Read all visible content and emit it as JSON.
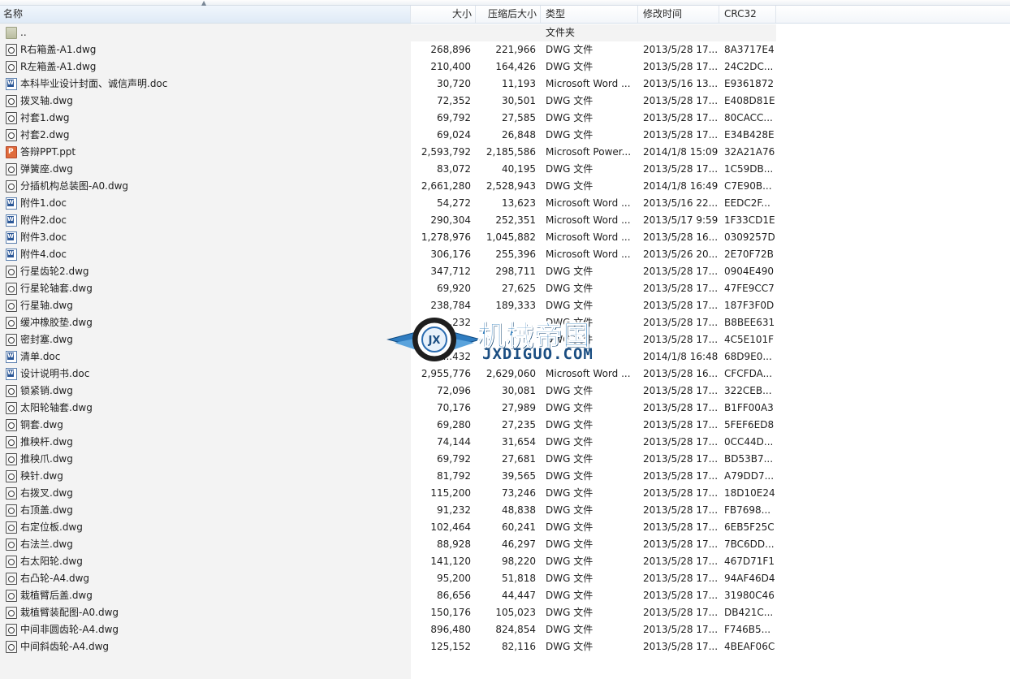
{
  "columns": {
    "name": "名称",
    "size": "大小",
    "packed": "压缩后大小",
    "type": "类型",
    "modified": "修改时间",
    "crc": "CRC32"
  },
  "parent_row": {
    "name": "..",
    "type": "文件夹"
  },
  "files": [
    {
      "name": "R右箱盖-A1.dwg",
      "size": "268,896",
      "packed": "221,966",
      "type": "DWG 文件",
      "modified": "2013/5/28 17...",
      "crc": "8A3717E4",
      "icon": "dwg-file-icon"
    },
    {
      "name": "R左箱盖-A1.dwg",
      "size": "210,400",
      "packed": "164,426",
      "type": "DWG 文件",
      "modified": "2013/5/28 17...",
      "crc": "24C2DC...",
      "icon": "dwg-file-icon"
    },
    {
      "name": "本科毕业设计封面、诚信声明.doc",
      "size": "30,720",
      "packed": "11,193",
      "type": "Microsoft Word ...",
      "modified": "2013/5/16 13...",
      "crc": "E9361872",
      "icon": "word-doc-icon"
    },
    {
      "name": "拨叉轴.dwg",
      "size": "72,352",
      "packed": "30,501",
      "type": "DWG 文件",
      "modified": "2013/5/28 17...",
      "crc": "E408D81E",
      "icon": "dwg-file-icon"
    },
    {
      "name": "衬套1.dwg",
      "size": "69,792",
      "packed": "27,585",
      "type": "DWG 文件",
      "modified": "2013/5/28 17...",
      "crc": "80CACC...",
      "icon": "dwg-file-icon"
    },
    {
      "name": "衬套2.dwg",
      "size": "69,024",
      "packed": "26,848",
      "type": "DWG 文件",
      "modified": "2013/5/28 17...",
      "crc": "E34B428E",
      "icon": "dwg-file-icon"
    },
    {
      "name": "答辩PPT.ppt",
      "size": "2,593,792",
      "packed": "2,185,586",
      "type": "Microsoft Power...",
      "modified": "2014/1/8 15:09",
      "crc": "32A21A76",
      "icon": "powerpoint-icon"
    },
    {
      "name": "弹簧座.dwg",
      "size": "83,072",
      "packed": "40,195",
      "type": "DWG 文件",
      "modified": "2013/5/28 17...",
      "crc": "1C59DB...",
      "icon": "dwg-file-icon"
    },
    {
      "name": "分插机构总装图-A0.dwg",
      "size": "2,661,280",
      "packed": "2,528,943",
      "type": "DWG 文件",
      "modified": "2014/1/8 16:49",
      "crc": "C7E90B...",
      "icon": "dwg-file-icon"
    },
    {
      "name": "附件1.doc",
      "size": "54,272",
      "packed": "13,623",
      "type": "Microsoft Word ...",
      "modified": "2013/5/16 22...",
      "crc": "EEDC2F...",
      "icon": "word-doc-icon"
    },
    {
      "name": "附件2.doc",
      "size": "290,304",
      "packed": "252,351",
      "type": "Microsoft Word ...",
      "modified": "2013/5/17 9:59",
      "crc": "1F33CD1E",
      "icon": "word-doc-icon"
    },
    {
      "name": "附件3.doc",
      "size": "1,278,976",
      "packed": "1,045,882",
      "type": "Microsoft Word ...",
      "modified": "2013/5/28 16...",
      "crc": "0309257D",
      "icon": "word-doc-icon"
    },
    {
      "name": "附件4.doc",
      "size": "306,176",
      "packed": "255,396",
      "type": "Microsoft Word ...",
      "modified": "2013/5/26 20...",
      "crc": "2E70F72B",
      "icon": "word-doc-icon"
    },
    {
      "name": "行星齿轮2.dwg",
      "size": "347,712",
      "packed": "298,711",
      "type": "DWG 文件",
      "modified": "2013/5/28 17...",
      "crc": "0904E490",
      "icon": "dwg-file-icon"
    },
    {
      "name": "行星轮轴套.dwg",
      "size": "69,920",
      "packed": "27,625",
      "type": "DWG 文件",
      "modified": "2013/5/28 17...",
      "crc": "47FE9CC7",
      "icon": "dwg-file-icon"
    },
    {
      "name": "行星轴.dwg",
      "size": "238,784",
      "packed": "189,333",
      "type": "DWG 文件",
      "modified": "2013/5/28 17...",
      "crc": "187F3F0D",
      "icon": "dwg-file-icon"
    },
    {
      "name": "缓冲橡胶垫.dwg",
      "size": "...232",
      "packed": "",
      "type": "DWG 文件",
      "modified": "2013/5/28 17...",
      "crc": "B8BEE631",
      "icon": "dwg-file-icon"
    },
    {
      "name": "密封塞.dwg",
      "size": "",
      "packed": "",
      "type": "DWG 文件",
      "modified": "2013/5/28 17...",
      "crc": "4C5E101F",
      "icon": "dwg-file-icon"
    },
    {
      "name": "清单.doc",
      "size": "...432",
      "packed": "",
      "type": "",
      "modified": "2014/1/8 16:48",
      "crc": "68D9E0...",
      "icon": "word-doc-icon"
    },
    {
      "name": "设计说明书.doc",
      "size": "2,955,776",
      "packed": "2,629,060",
      "type": "Microsoft Word ...",
      "modified": "2013/5/28 16...",
      "crc": "CFCFDA...",
      "icon": "word-doc-icon"
    },
    {
      "name": "锁紧销.dwg",
      "size": "72,096",
      "packed": "30,081",
      "type": "DWG 文件",
      "modified": "2013/5/28 17...",
      "crc": "322CEB...",
      "icon": "dwg-file-icon"
    },
    {
      "name": "太阳轮轴套.dwg",
      "size": "70,176",
      "packed": "27,989",
      "type": "DWG 文件",
      "modified": "2013/5/28 17...",
      "crc": "B1FF00A3",
      "icon": "dwg-file-icon"
    },
    {
      "name": "铜套.dwg",
      "size": "69,280",
      "packed": "27,235",
      "type": "DWG 文件",
      "modified": "2013/5/28 17...",
      "crc": "5FEF6ED8",
      "icon": "dwg-file-icon"
    },
    {
      "name": "推秧杆.dwg",
      "size": "74,144",
      "packed": "31,654",
      "type": "DWG 文件",
      "modified": "2013/5/28 17...",
      "crc": "0CC44D...",
      "icon": "dwg-file-icon"
    },
    {
      "name": "推秧爪.dwg",
      "size": "69,792",
      "packed": "27,681",
      "type": "DWG 文件",
      "modified": "2013/5/28 17...",
      "crc": "BD53B7...",
      "icon": "dwg-file-icon"
    },
    {
      "name": "秧针.dwg",
      "size": "81,792",
      "packed": "39,565",
      "type": "DWG 文件",
      "modified": "2013/5/28 17...",
      "crc": "A79DD7...",
      "icon": "dwg-file-icon"
    },
    {
      "name": "右拨叉.dwg",
      "size": "115,200",
      "packed": "73,246",
      "type": "DWG 文件",
      "modified": "2013/5/28 17...",
      "crc": "18D10E24",
      "icon": "dwg-file-icon"
    },
    {
      "name": "右顶盖.dwg",
      "size": "91,232",
      "packed": "48,838",
      "type": "DWG 文件",
      "modified": "2013/5/28 17...",
      "crc": "FB7698...",
      "icon": "dwg-file-icon"
    },
    {
      "name": "右定位板.dwg",
      "size": "102,464",
      "packed": "60,241",
      "type": "DWG 文件",
      "modified": "2013/5/28 17...",
      "crc": "6EB5F25C",
      "icon": "dwg-file-icon"
    },
    {
      "name": "右法兰.dwg",
      "size": "88,928",
      "packed": "46,297",
      "type": "DWG 文件",
      "modified": "2013/5/28 17...",
      "crc": "7BC6DD...",
      "icon": "dwg-file-icon"
    },
    {
      "name": "右太阳轮.dwg",
      "size": "141,120",
      "packed": "98,220",
      "type": "DWG 文件",
      "modified": "2013/5/28 17...",
      "crc": "467D71F1",
      "icon": "dwg-file-icon"
    },
    {
      "name": "右凸轮-A4.dwg",
      "size": "95,200",
      "packed": "51,818",
      "type": "DWG 文件",
      "modified": "2013/5/28 17...",
      "crc": "94AF46D4",
      "icon": "dwg-file-icon"
    },
    {
      "name": "栽植臂后盖.dwg",
      "size": "86,656",
      "packed": "44,447",
      "type": "DWG 文件",
      "modified": "2013/5/28 17...",
      "crc": "31980C46",
      "icon": "dwg-file-icon"
    },
    {
      "name": "栽植臂装配图-A0.dwg",
      "size": "150,176",
      "packed": "105,023",
      "type": "DWG 文件",
      "modified": "2013/5/28 17...",
      "crc": "DB421C...",
      "icon": "dwg-file-icon"
    },
    {
      "name": "中间非圆齿轮-A4.dwg",
      "size": "896,480",
      "packed": "824,854",
      "type": "DWG 文件",
      "modified": "2013/5/28 17...",
      "crc": "F746B5...",
      "icon": "dwg-file-icon"
    },
    {
      "name": "中间斜齿轮-A4.dwg",
      "size": "125,152",
      "packed": "82,116",
      "type": "DWG 文件",
      "modified": "2013/5/28 17...",
      "crc": "4BEAF06C",
      "icon": "dwg-file-icon"
    }
  ],
  "watermark": {
    "title": "机械帝国",
    "url": "JXDIGUO.COM",
    "emblem": "JX"
  }
}
